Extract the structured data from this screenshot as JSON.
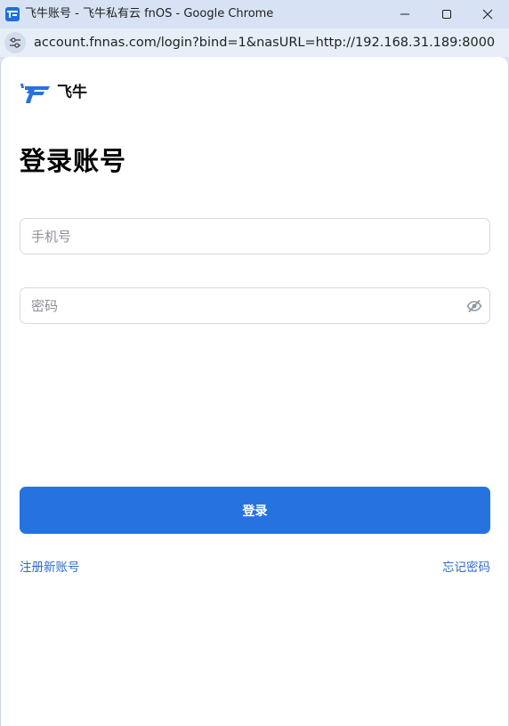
{
  "window": {
    "title": "飞牛账号 - 飞牛私有云 fnOS - Google Chrome",
    "favicon_icon": "fn-favicon-icon"
  },
  "address_bar": {
    "url": "account.fnnas.com/login?bind=1&nasURL=http://192.168.31.189:8000"
  },
  "brand": {
    "logo_text": "飞牛",
    "accent_color": "#2673e0"
  },
  "login": {
    "heading": "登录账号",
    "phone_placeholder": "手机号",
    "password_placeholder": "密码",
    "submit_label": "登录",
    "register_link": "注册新账号",
    "forgot_link": "忘记密码"
  }
}
